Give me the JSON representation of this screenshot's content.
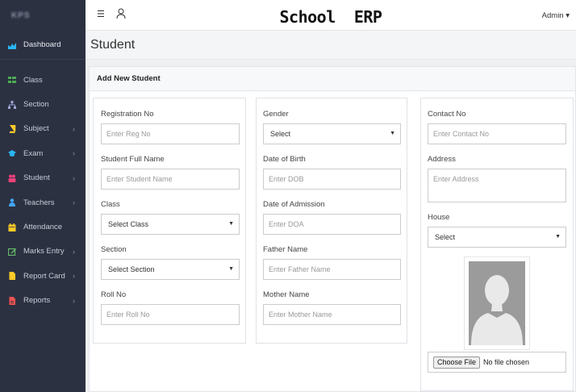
{
  "sidebar": {
    "brand": "KPS",
    "dashboard": "Dashboard",
    "items": [
      {
        "label": "Class",
        "icon": "grid-icon",
        "color": "#4caf50",
        "chevron": false
      },
      {
        "label": "Section",
        "icon": "hierarchy-icon",
        "color": "#9fa8da",
        "chevron": false
      },
      {
        "label": "Subject",
        "icon": "book-icon",
        "color": "#ffca28",
        "chevron": true
      },
      {
        "label": "Exam",
        "icon": "graduation-cap-icon",
        "color": "#29b6f6",
        "chevron": true
      },
      {
        "label": "Student",
        "icon": "users-icon",
        "color": "#ec407a",
        "chevron": true
      },
      {
        "label": "Teachers",
        "icon": "user-icon",
        "color": "#42a5f5",
        "chevron": true
      },
      {
        "label": "Attendance",
        "icon": "calendar-icon",
        "color": "#ffca28",
        "chevron": false
      },
      {
        "label": "Marks Entry",
        "icon": "edit-icon",
        "color": "#66bb6a",
        "chevron": true
      },
      {
        "label": "Report Card",
        "icon": "file-icon",
        "color": "#ffca28",
        "chevron": true
      },
      {
        "label": "Reports",
        "icon": "report-icon",
        "color": "#ef5350",
        "chevron": true
      }
    ]
  },
  "topbar": {
    "title": "School  ERP",
    "admin": "Admin ▾",
    "menu_glyph": "☰"
  },
  "page": {
    "title": "Student",
    "card_title": "Add New Student"
  },
  "form": {
    "reg_label": "Registration No",
    "reg_placeholder": "Enter Reg No",
    "name_label": "Student Full Name",
    "name_placeholder": "Enter Student Name",
    "class_label": "Class",
    "class_value": "Select Class",
    "section_label": "Section",
    "section_value": "Select Section",
    "roll_label": "Roll No",
    "roll_placeholder": "Enter Roll No",
    "gender_label": "Gender",
    "gender_value": "Select",
    "dob_label": "Date of Birth",
    "dob_placeholder": "Enter DOB",
    "doa_label": "Date of Admission",
    "doa_placeholder": "Enter DOA",
    "father_label": "Father Name",
    "father_placeholder": "Enter Father Name",
    "mother_label": "Mother Name",
    "mother_placeholder": "Enter Mother Name",
    "contact_label": "Contact No",
    "contact_placeholder": "Enter Contact No",
    "address_label": "Address",
    "address_placeholder": "Enter Address",
    "house_label": "House",
    "house_value": "Select",
    "file_button": "Choose File",
    "file_status": "No file chosen"
  },
  "colors": {
    "sidebar_bg": "#2c3142",
    "dashboard_icon": "#29b6f6"
  }
}
